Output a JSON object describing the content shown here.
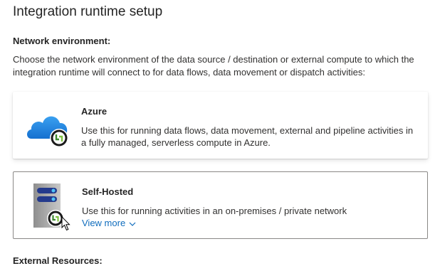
{
  "dialog": {
    "title": "Integration runtime setup",
    "network_label": "Network environment:",
    "description": "Choose the network environment of the data source / destination or external compute to which the integration runtime will connect to for data flows, data movement or dispatch activities:",
    "next_section_label": "External Resources:"
  },
  "options": [
    {
      "title": "Azure",
      "text": "Use this for running data flows, data movement, external and pipeline activities in a fully managed, serverless compute in Azure.",
      "icon": "azure-cloud-icon"
    },
    {
      "title": "Self-Hosted",
      "text": "Use this for running activities in an on-premises / private network",
      "link": "View more",
      "icon": "server-icon",
      "selected": true
    }
  ],
  "colors": {
    "accent": "#0f6cbd",
    "cloud": "#1e90e0",
    "badge": "#3c8a2e"
  }
}
